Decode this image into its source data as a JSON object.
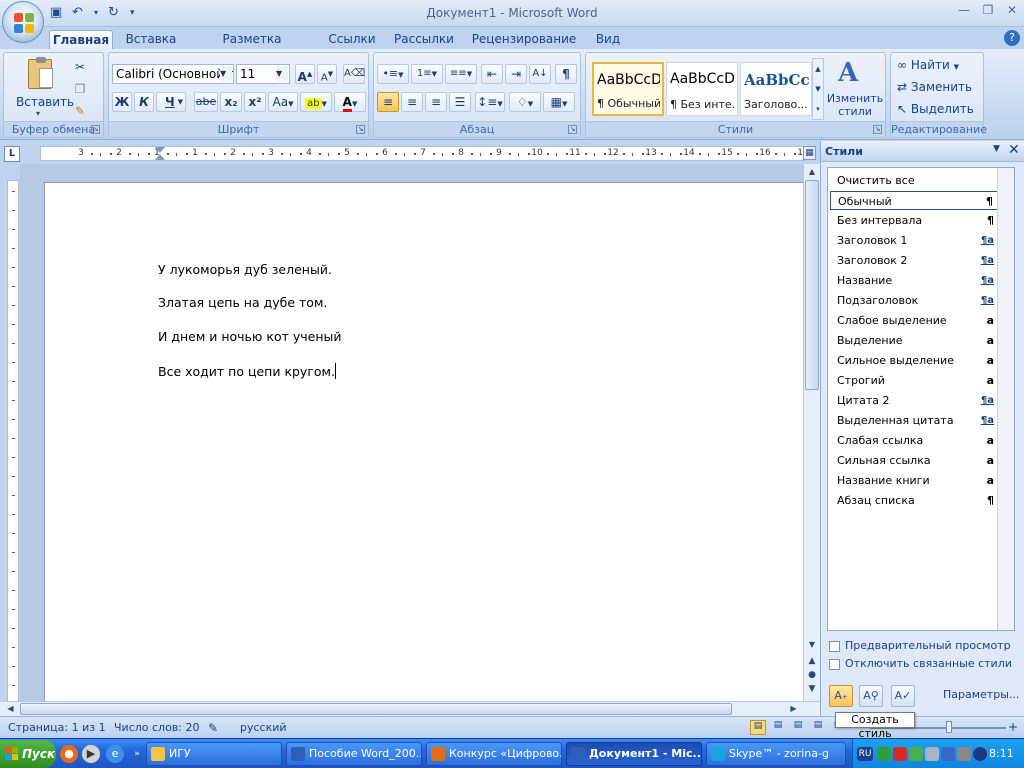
{
  "window": {
    "title": "Документ1 - Microsoft Word"
  },
  "quick_access": [
    "save-icon",
    "undo-icon",
    "redo-icon",
    "customize-icon"
  ],
  "tabs": [
    "Главная",
    "Вставка",
    "Разметка страницы",
    "Ссылки",
    "Рассылки",
    "Рецензирование",
    "Вид"
  ],
  "active_tab": "Главная",
  "ribbon": {
    "clipboard": {
      "label": "Буфер обмена",
      "paste_label": "Вставить"
    },
    "font": {
      "label": "Шрифт",
      "font_name": "Calibri (Основной те",
      "font_size": "11",
      "bold": "Ж",
      "italic": "К",
      "underline": "Ч",
      "strike": "abe",
      "sub": "x₂",
      "sup": "x²",
      "case": "Aa",
      "grow": "A",
      "shrink": "A",
      "color": "A"
    },
    "paragraph": {
      "label": "Абзац",
      "pilcrow": "¶"
    },
    "styles": {
      "label": "Стили",
      "change_label": "Изменить стили",
      "gallery": [
        {
          "sample": "AaBbCcDc",
          "name": "¶ Обычный",
          "selected": true
        },
        {
          "sample": "AaBbCcDc",
          "name": "¶ Без инте...",
          "selected": false
        },
        {
          "sample": "AaBbCc",
          "name": "Заголово...",
          "selected": false
        }
      ]
    },
    "editing": {
      "label": "Редактирование",
      "find": "Найти",
      "replace": "Заменить",
      "select": "Выделить"
    }
  },
  "ruler": {
    "numbers": [
      "3",
      "2",
      "1",
      "1",
      "2",
      "3",
      "4",
      "5",
      "6",
      "7",
      "8",
      "9",
      "10",
      "11",
      "12",
      "13",
      "14",
      "15",
      "16",
      "17"
    ]
  },
  "document": {
    "paragraphs": [
      "У лукоморья дуб зеленый.",
      "Златая цепь на дубе том.",
      "И днем и ночью кот ученый",
      "Все ходит по цепи кругом."
    ]
  },
  "styles_pane": {
    "title": "Стили",
    "items": [
      {
        "name": "Очистить все",
        "mark": ""
      },
      {
        "name": "Обычный",
        "mark": "¶",
        "selected": true
      },
      {
        "name": "Без интервала",
        "mark": "¶"
      },
      {
        "name": "Заголовок 1",
        "mark": "¶a"
      },
      {
        "name": "Заголовок 2",
        "mark": "¶a"
      },
      {
        "name": "Название",
        "mark": "¶a"
      },
      {
        "name": "Подзаголовок",
        "mark": "¶a"
      },
      {
        "name": "Слабое выделение",
        "mark": "a"
      },
      {
        "name": "Выделение",
        "mark": "a"
      },
      {
        "name": "Сильное выделение",
        "mark": "a"
      },
      {
        "name": "Строгий",
        "mark": "a"
      },
      {
        "name": "Цитата 2",
        "mark": "¶a"
      },
      {
        "name": "Выделенная цитата",
        "mark": "¶a"
      },
      {
        "name": "Слабая ссылка",
        "mark": "a"
      },
      {
        "name": "Сильная ссылка",
        "mark": "a"
      },
      {
        "name": "Название книги",
        "mark": "a"
      },
      {
        "name": "Абзац списка",
        "mark": "¶"
      }
    ],
    "preview_label": "Предварительный просмотр",
    "disable_linked_label": "Отключить связанные стили",
    "params_label": "Параметры...",
    "tooltip": "Создать стиль"
  },
  "statusbar": {
    "page": "Страница: 1 из 1",
    "words": "Число слов: 20",
    "lang": "русский"
  },
  "taskbar": {
    "start": "Пуск",
    "buttons": [
      {
        "label": "ИГУ",
        "active": false
      },
      {
        "label": "Пособие Word_200...",
        "active": false
      },
      {
        "label": "Конкурс «Цифрово...",
        "active": false
      },
      {
        "label": "Документ1 - Mic...",
        "active": true
      },
      {
        "label": "Skype™ - zorina-g",
        "active": false
      }
    ],
    "lang": "RU",
    "clock": "8:11"
  }
}
